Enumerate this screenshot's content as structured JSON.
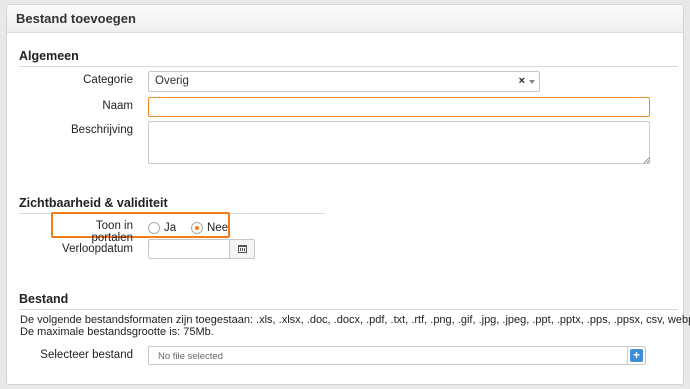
{
  "panel": {
    "title": "Bestand toevoegen"
  },
  "general": {
    "heading": "Algemeen",
    "category_label": "Categorie",
    "category_value": "Overig",
    "category_clear": "×",
    "name_label": "Naam",
    "name_value": "",
    "description_label": "Beschrijving",
    "description_value": ""
  },
  "visibility": {
    "heading": "Zichtbaarheid & validiteit",
    "portal_label": "Toon in portalen",
    "options": [
      {
        "label": "Ja",
        "checked": false
      },
      {
        "label": "Nee",
        "checked": true
      }
    ],
    "expiry_label": "Verloopdatum",
    "expiry_value": ""
  },
  "file": {
    "heading": "Bestand",
    "formats_text": "De volgende bestandsformaten zijn toegestaan: .xls, .xlsx, .doc, .docx, .pdf, .txt, .rtf, .png, .gif, .jpg, .jpeg, .ppt, .pptx, .pps, .ppsx, csv, webp",
    "max_size_text": "De maximale bestandsgrootte is: 75Mb.",
    "select_label": "Selecteer bestand",
    "no_file_text": "No file selected",
    "add_symbol": "+"
  },
  "colors": {
    "accent": "#f07d1a",
    "button_blue": "#3b8fd6",
    "focus_border": "#f08a24"
  }
}
